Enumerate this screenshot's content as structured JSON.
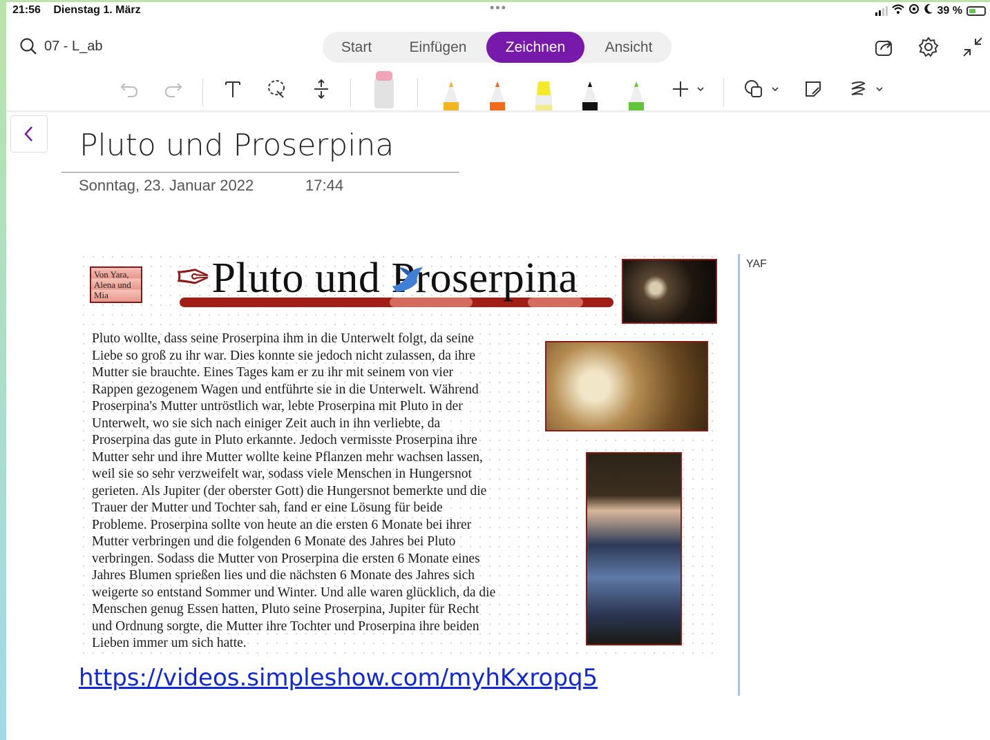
{
  "status_bar": {
    "time": "21:56",
    "date": "Dienstag 1. März",
    "battery": "39 %",
    "icons": [
      "signal-icon",
      "wifi-icon",
      "rotation-lock-icon",
      "moon-icon",
      "battery-charging-icon"
    ]
  },
  "header": {
    "notebook_title": "07 - L_ab",
    "tabs": [
      {
        "label": "Start",
        "active": false
      },
      {
        "label": "Einfügen",
        "active": false
      },
      {
        "label": "Zeichnen",
        "active": true
      },
      {
        "label": "Ansicht",
        "active": false
      }
    ],
    "accent_color": "#7719aa",
    "right_icons": [
      "share-icon",
      "gear-icon",
      "collapse-icon"
    ]
  },
  "toolbar": {
    "tools": [
      "undo-icon",
      "redo-icon",
      "text-icon",
      "lasso-icon",
      "insert-space-icon",
      "eraser-icon"
    ],
    "pens": [
      {
        "name": "pencil-yellow",
        "color": "#f2b620"
      },
      {
        "name": "pencil-orange",
        "color": "#f06a1d"
      },
      {
        "name": "highlighter-yellow",
        "color": "#f5ea2a"
      },
      {
        "name": "pen-black",
        "color": "#111111"
      },
      {
        "name": "pen-green",
        "color": "#63c33b"
      }
    ],
    "more": [
      "add-pen-icon",
      "shapes-icon",
      "ink-to-shape-icon",
      "ink-replay-icon"
    ]
  },
  "page": {
    "title": "Pluto und Proserpina",
    "date": "Sonntag, 23. Januar 2022",
    "time": "17:44",
    "margin_note": "YAF",
    "link": "https://videos.simpleshow.com/myhKxropq5"
  },
  "poster": {
    "authors": "Von Yara, Alena und Mia",
    "title": "Pluto und Proserpina",
    "text_lines": [
      "Pluto wollte, dass seine Proserpina ihm in die Unterwelt folgt, da seine",
      "Liebe so groß zu ihr war. Dies konnte sie jedoch nicht zulassen, da ihre",
      "Mutter sie brauchte. Eines Tages kam er zu ihr mit seinem von vier",
      "Rappen gezogenem Wagen und entführte sie in die Unterwelt. Während",
      "Proserpina's Mutter untröstlich war, lebte Proserpina mit Pluto in der",
      "Unterwelt, wo sie sich nach einiger Zeit auch in ihn verliebte, da",
      "Proserpina das gute in Pluto erkannte. Jedoch vermisste Proserpina ihre",
      "Mutter sehr und ihre Mutter wollte keine Pflanzen mehr wachsen lassen,",
      "weil sie so sehr verzweifelt war, sodass viele Menschen in Hungersnot",
      "gerieten. Als Jupiter (der oberster Gott) die Hungersnot bemerkte und die",
      "Trauer der Mutter und Tochter sah, fand er eine Lösung für beide",
      "Probleme. Proserpina sollte von heute an die ersten 6 Monate bei ihrer",
      "Mutter verbringen und die folgenden 6 Monate des Jahres bei Pluto",
      "verbringen. Sodass die Mutter von Proserpina die ersten 6 Monate eines",
      "Jahres Blumen sprießen lies und die nächsten 6 Monate des Jahres sich",
      "weigerte so entstand Sommer und Winter. Und alle waren glücklich, da die",
      "Menschen genug Essen hatten, Pluto seine Proserpina, Jupiter für Recht",
      "und Ordnung sorgte, die Mutter ihre Tochter und Proserpina ihre beiden",
      "Lieben immer um sich hatte."
    ]
  }
}
